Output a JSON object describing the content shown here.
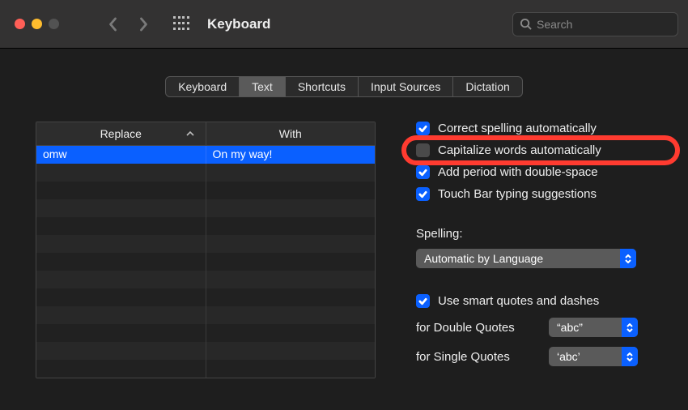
{
  "titlebar": {
    "title": "Keyboard",
    "search_placeholder": "Search"
  },
  "tabs": [
    {
      "label": "Keyboard",
      "active": false
    },
    {
      "label": "Text",
      "active": true
    },
    {
      "label": "Shortcuts",
      "active": false
    },
    {
      "label": "Input Sources",
      "active": false
    },
    {
      "label": "Dictation",
      "active": false
    }
  ],
  "table": {
    "columns": {
      "replace": "Replace",
      "with": "With"
    },
    "rows": [
      {
        "replace": "omw",
        "with": "On my way!",
        "selected": true
      }
    ],
    "empty_rows": 12
  },
  "options": {
    "correct_spelling": {
      "label": "Correct spelling automatically",
      "checked": true
    },
    "capitalize": {
      "label": "Capitalize words automatically",
      "checked": false,
      "highlighted": true
    },
    "add_period": {
      "label": "Add period with double-space",
      "checked": true
    },
    "touch_bar": {
      "label": "Touch Bar typing suggestions",
      "checked": true
    },
    "spelling_label": "Spelling:",
    "spelling_value": "Automatic by Language",
    "smart_quotes": {
      "label": "Use smart quotes and dashes",
      "checked": true
    },
    "double_quotes_label": "for Double Quotes",
    "double_quotes_value": "“abc”",
    "single_quotes_label": "for Single Quotes",
    "single_quotes_value": "‘abc’"
  }
}
